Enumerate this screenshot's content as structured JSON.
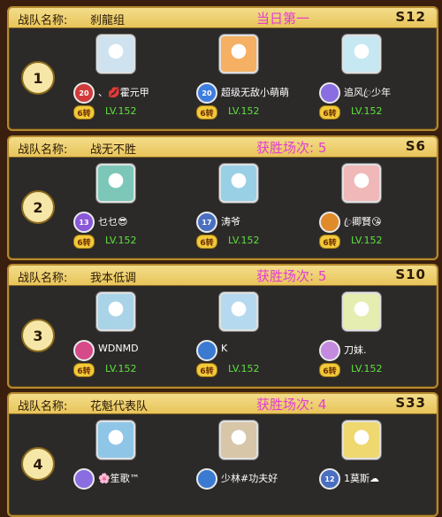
{
  "labels": {
    "team_label": "战队名称:"
  },
  "teams": [
    {
      "rank": "1",
      "name": "刹龍组",
      "status": "当日第一",
      "server": "S12",
      "members": [
        {
          "name": "、💋霍元甲",
          "tier": "6转",
          "level": "LV.152",
          "badge": "20",
          "badge_color": "#d13a3a",
          "avatar_color": "#cfe2ef"
        },
        {
          "name": "超级无敌小萌萌",
          "tier": "6转",
          "level": "LV.152",
          "badge": "20",
          "badge_color": "#3e7ee0",
          "avatar_color": "#f5b063"
        },
        {
          "name": "追风ꦿ少年",
          "tier": "6转",
          "level": "LV.152",
          "badge": "",
          "badge_color": "#8a6de0",
          "avatar_color": "#c6e8f2"
        }
      ]
    },
    {
      "rank": "2",
      "name": "战无不胜",
      "status": "获胜场次: 5",
      "server": "S6",
      "members": [
        {
          "name": "乜乜😎",
          "tier": "6转",
          "level": "LV.152",
          "badge": "13",
          "badge_color": "#8a58d8",
          "avatar_color": "#7cc7b8"
        },
        {
          "name": "涛爷",
          "tier": "6转",
          "level": "LV.152",
          "badge": "17",
          "badge_color": "#4a6fc0",
          "avatar_color": "#9ad0e6"
        },
        {
          "name": "ꦿ卿賢😘",
          "tier": "6转",
          "level": "LV.152",
          "badge": "",
          "badge_color": "#e08a2a",
          "avatar_color": "#f0b8b8"
        }
      ]
    },
    {
      "rank": "3",
      "name": "我本低调",
      "status": "获胜场次: 5",
      "server": "S10",
      "members": [
        {
          "name": "WDNMD",
          "tier": "6转",
          "level": "LV.152",
          "badge": "",
          "badge_color": "#d64a8a",
          "avatar_color": "#a9d4e8"
        },
        {
          "name": "K",
          "tier": "6转",
          "level": "LV.152",
          "badge": "",
          "badge_color": "#3a7ad0",
          "avatar_color": "#b5daf0"
        },
        {
          "name": "刀妹.",
          "tier": "6转",
          "level": "LV.152",
          "badge": "",
          "badge_color": "#c48adf",
          "avatar_color": "#e6edb0"
        }
      ]
    },
    {
      "rank": "4",
      "name": "花魁代表队",
      "status": "获胜场次: 4",
      "server": "S33",
      "members": [
        {
          "name": "🌸笙歌™",
          "tier": "",
          "level": "",
          "badge": "",
          "badge_color": "#8a6de0",
          "avatar_color": "#8fc6e8"
        },
        {
          "name": "少林#功夫好",
          "tier": "",
          "level": "",
          "badge": "",
          "badge_color": "#3a7ad0",
          "avatar_color": "#d7c6a8"
        },
        {
          "name": "1莫斯☁",
          "tier": "",
          "level": "",
          "badge": "12",
          "badge_color": "#4a6fc0",
          "avatar_color": "#f0d870"
        }
      ]
    }
  ]
}
